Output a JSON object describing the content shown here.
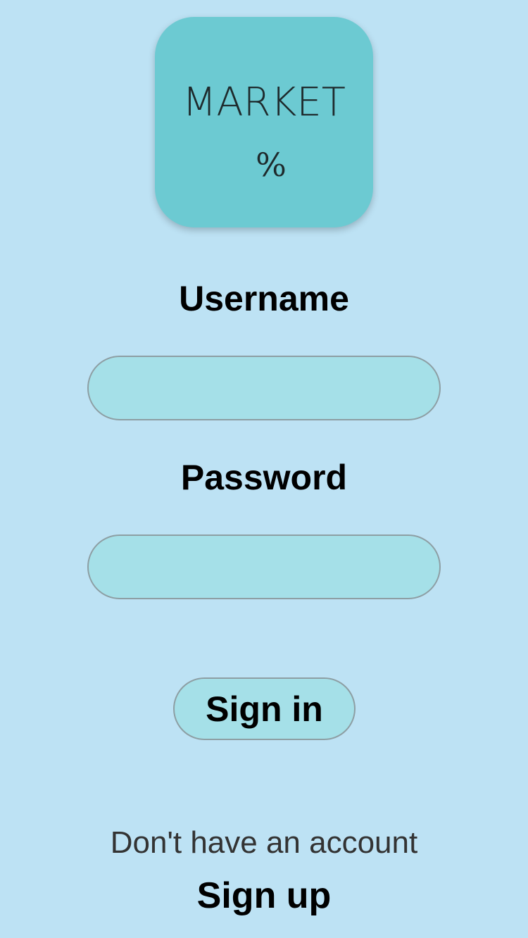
{
  "logo": {
    "wordmark": "MARKET",
    "symbol": "%",
    "background_color": "#6ccad2"
  },
  "form": {
    "username_label": "Username",
    "username_value": "",
    "username_placeholder": "",
    "password_label": "Password",
    "password_value": "",
    "password_placeholder": "",
    "sign_in_label": "Sign in"
  },
  "footer": {
    "no_account_text": "Don't have an account",
    "sign_up_label": "Sign up"
  },
  "colors": {
    "background": "#bde2f4",
    "field_fill": "#a5e0e8",
    "field_border": "#8d9ea3"
  }
}
